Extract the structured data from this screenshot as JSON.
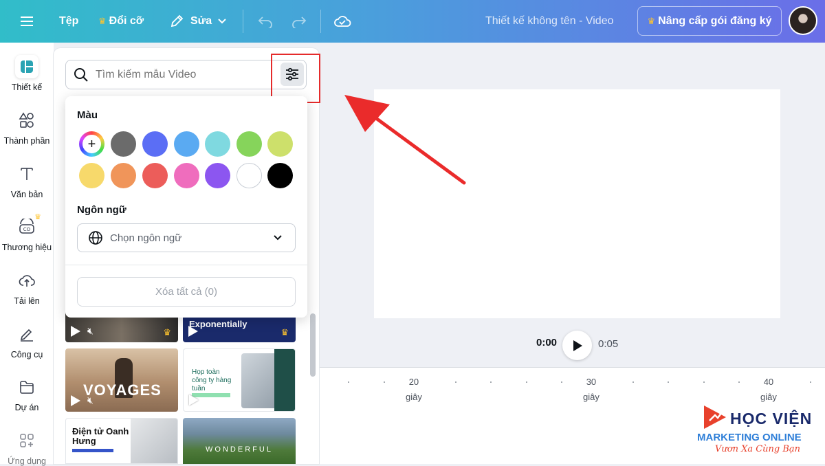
{
  "topbar": {
    "file_label": "Tệp",
    "resize_label": "Đổi cỡ",
    "edit_label": "Sửa",
    "doc_title": "Thiết kế không tên - Video",
    "upgrade_label": "Nâng cấp gói đăng ký"
  },
  "sidebar": {
    "items": [
      {
        "label": "Thiết kế",
        "icon": "design-icon"
      },
      {
        "label": "Thành phần",
        "icon": "elements-icon"
      },
      {
        "label": "Văn bản",
        "icon": "text-icon"
      },
      {
        "label": "Thương hiệu",
        "icon": "brand-icon"
      },
      {
        "label": "Tải lên",
        "icon": "upload-cloud-icon"
      },
      {
        "label": "Công cụ",
        "icon": "tools-icon"
      },
      {
        "label": "Dự án",
        "icon": "folder-icon"
      },
      {
        "label": "Ứng dụng",
        "icon": "apps-icon"
      }
    ]
  },
  "search": {
    "placeholder": "Tìm kiếm mẫu Video"
  },
  "filter": {
    "color_heading": "Màu",
    "colors_row1": [
      "#6b6b6b",
      "#5b6ef5",
      "#5aaaf2",
      "#7fd9e0",
      "#86d45b",
      "#cde06b"
    ],
    "colors_row2": [
      "#f7d96b",
      "#f0955a",
      "#ec5d5a",
      "#ef6dbd",
      "#8c56f0",
      "#ffffff",
      "#000000"
    ],
    "language_heading": "Ngôn ngữ",
    "language_placeholder": "Chọn ngôn ngữ",
    "clear_label": "Xóa tất cả (0)"
  },
  "templates": [
    {
      "text": ""
    },
    {
      "text": "Exponentially"
    },
    {
      "text": "VOYAGES"
    },
    {
      "text": "Họp toàn công ty hàng tuần"
    },
    {
      "text": "Điện tử Oanh Hưng"
    },
    {
      "text": "WONDERFUL"
    }
  ],
  "playback": {
    "current": "0:00",
    "total": "0:05"
  },
  "timeline": {
    "ticks": [
      {
        "value": "20",
        "unit": "giây"
      },
      {
        "value": "30",
        "unit": "giây"
      },
      {
        "value": "40",
        "unit": "giây"
      }
    ]
  },
  "watermark": {
    "line1": "HỌC VIỆN",
    "line2": "MARKETING ONLINE",
    "line3": "Vươn Xa Cùng Bạn"
  }
}
